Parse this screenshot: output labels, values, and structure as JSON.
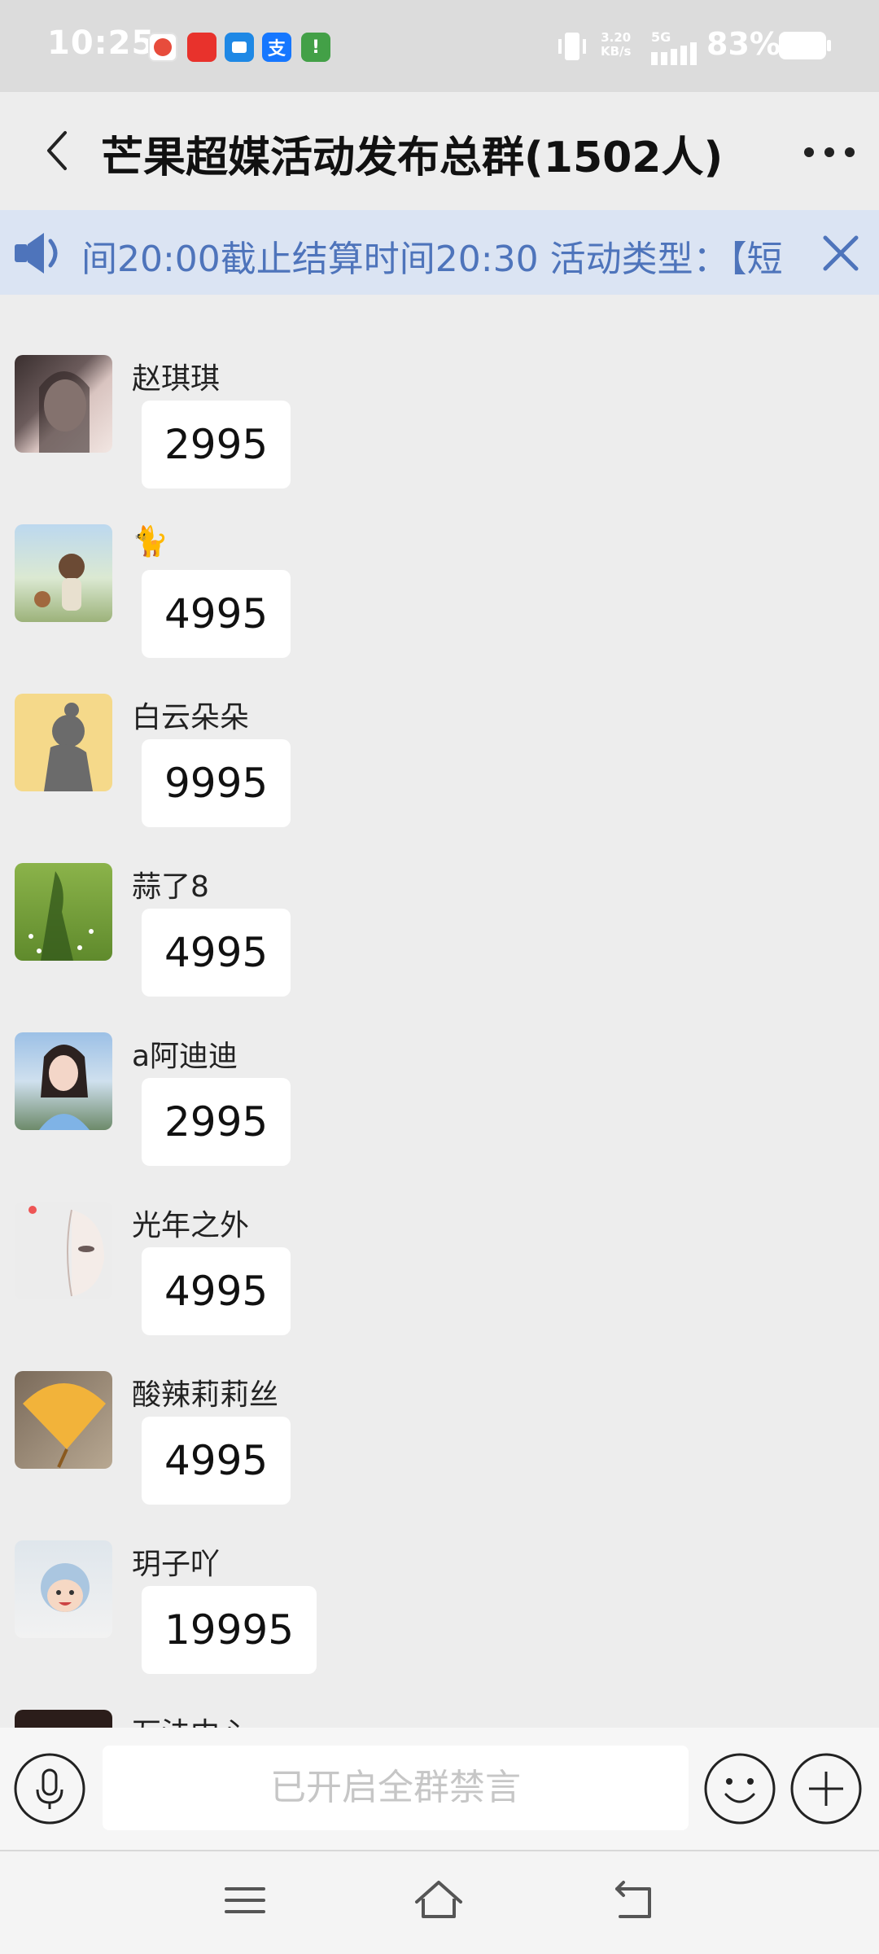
{
  "status_bar": {
    "time": "10:25",
    "net_speed_value": "3.20",
    "net_speed_unit": "KB/s",
    "network": "5G",
    "battery": "83%"
  },
  "header": {
    "title": "芒果超媒活动发布总群(1502人)",
    "back_icon": "chevron-left-icon",
    "more_icon": "more-dots-icon"
  },
  "announcement": {
    "text": "间20:00截止结算时间20:30 活动类型：【短",
    "speaker_icon": "speaker-icon",
    "close_icon": "close-icon"
  },
  "messages": [
    {
      "sender": "赵琪琪",
      "text": "2995"
    },
    {
      "sender": "🐈",
      "text": "4995"
    },
    {
      "sender": "白云朵朵",
      "text": "9995"
    },
    {
      "sender": "蒜了8",
      "text": "4995"
    },
    {
      "sender": "a阿迪迪",
      "text": "2995"
    },
    {
      "sender": "光年之外",
      "text": "4995"
    },
    {
      "sender": "酸辣莉莉丝",
      "text": "4995"
    },
    {
      "sender": "玥子吖",
      "text": "19995"
    },
    {
      "sender": "万法中心",
      "text": ""
    }
  ],
  "input_bar": {
    "muted_text": "已开启全群禁言"
  },
  "colors": {
    "background": "#ededed",
    "announcement_bg": "#dbe4f3",
    "announcement_text": "#4e74bb"
  }
}
